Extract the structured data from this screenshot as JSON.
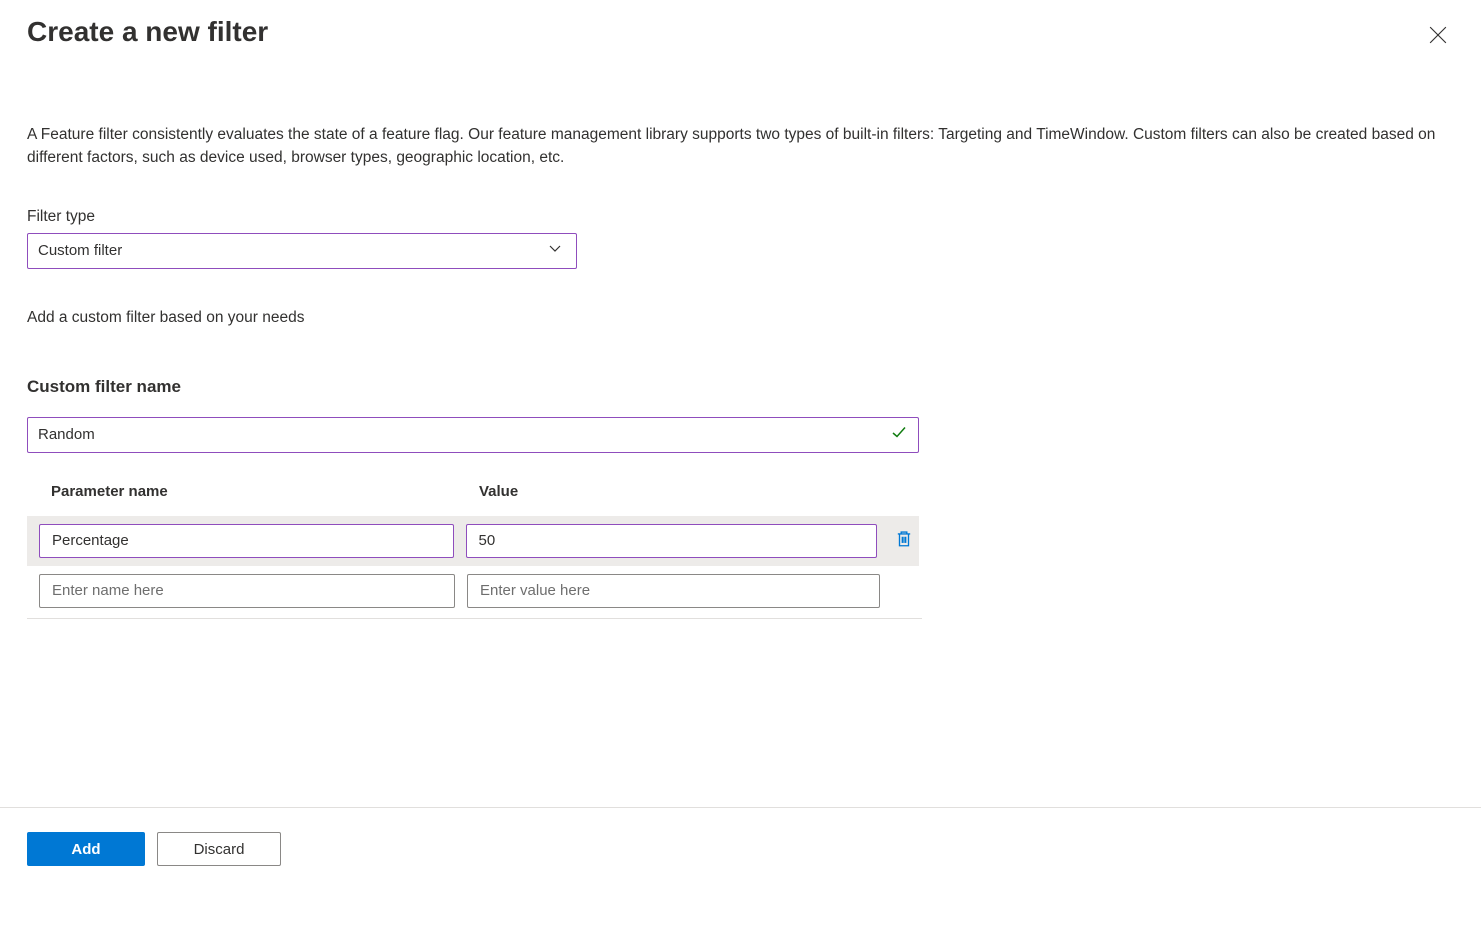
{
  "header": {
    "title": "Create a new filter"
  },
  "description": "A Feature filter consistently evaluates the state of a feature flag. Our feature management library supports two types of built-in filters: Targeting and TimeWindow. Custom filters can also be created based on different factors, such as device used, browser types, geographic location, etc.",
  "filterType": {
    "label": "Filter type",
    "selected": "Custom filter"
  },
  "helperText": "Add a custom filter based on your needs",
  "customFilter": {
    "label": "Custom filter name",
    "value": "Random"
  },
  "paramsTable": {
    "headers": {
      "name": "Parameter name",
      "value": "Value"
    },
    "rows": [
      {
        "name": "Percentage",
        "value": "50"
      }
    ],
    "placeholders": {
      "name": "Enter name here",
      "value": "Enter value here"
    }
  },
  "footer": {
    "primary": "Add",
    "secondary": "Discard"
  }
}
